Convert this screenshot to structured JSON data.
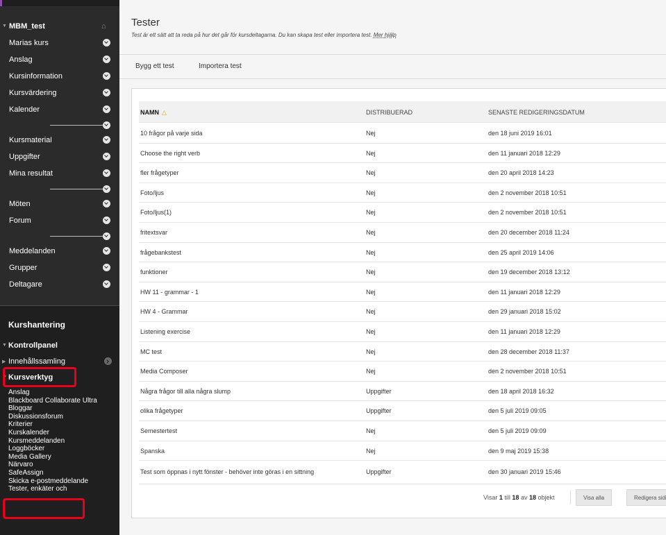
{
  "sidebar": {
    "course_title": "MBM_test",
    "groups": [
      [
        "Marias kurs",
        "Anslag",
        "Kursinformation",
        "Kursvärdering",
        "Kalender"
      ],
      [
        "Kursmaterial",
        "Uppgifter",
        "Mina resultat"
      ],
      [
        "Möten",
        "Forum"
      ],
      [
        "Meddelanden",
        "Grupper",
        "Deltagare"
      ]
    ],
    "management": {
      "title": "Kurshantering",
      "control_panel": "Kontrollpanel",
      "content_collection": "Innehållssamling",
      "course_tools": "Kursverktyg",
      "tools": [
        "Anslag",
        "Blackboard Collaborate Ultra",
        "Bloggar",
        "Diskussionsforum",
        "Kriterier",
        "Kurskalender",
        "Kursmeddelanden",
        "Loggböcker",
        "Media Gallery",
        "Närvaro",
        "SafeAssign",
        "Skicka e-postmeddelande",
        "Tester, enkäter och"
      ]
    },
    "highlight_color": "#e8001c"
  },
  "main": {
    "title": "Tester",
    "description": "Test är ett sätt att ta reda på hur det går för kursdeltagarna. Du kan skapa test eller importera test.",
    "help_link": "Mer hjälp",
    "toolbar": {
      "build_test": "Bygg ett test",
      "import_test": "Importera test"
    },
    "table": {
      "columns": [
        "NAMN",
        "DISTRIBUERAD",
        "SENASTE REDIGERINGSDATUM"
      ],
      "rows": [
        [
          "10 frågor på varje sida",
          "Nej",
          "den 18 juni 2019 16:01"
        ],
        [
          "Choose the right verb",
          "Nej",
          "den 11 januari 2018 12:29"
        ],
        [
          "fler frågetyper",
          "Nej",
          "den 20 april 2018 14:23"
        ],
        [
          "Foto/ljus",
          "Nej",
          "den 2 november 2018 10:51"
        ],
        [
          "Foto/ljus(1)",
          "Nej",
          "den 2 november 2018 10:51"
        ],
        [
          "fritextsvar",
          "Nej",
          "den 20 december 2018 11:24"
        ],
        [
          "frågebankstest",
          "Nej",
          "den 25 april 2019 14:06"
        ],
        [
          "funktioner",
          "Nej",
          "den 19 december 2018 13:12"
        ],
        [
          "HW 11 - grammar - 1",
          "Nej",
          "den 11 januari 2018 12:29"
        ],
        [
          "HW 4 - Grammar",
          "Nej",
          "den 29 januari 2018 15:02"
        ],
        [
          "Listening exercise",
          "Nej",
          "den 11 januari 2018 12:29"
        ],
        [
          "MC test",
          "Nej",
          "den 28 december 2018 11:37"
        ],
        [
          "Media Composer",
          "Nej",
          "den 2 november 2018 10:51"
        ],
        [
          "Några frågor till alla några slump",
          "Uppgifter",
          "den 18 april 2018 16:32"
        ],
        [
          "olika frågetyper",
          "Uppgifter",
          "den 5 juli 2019 09:05"
        ],
        [
          "Semestertest",
          "Nej",
          "den 5 juli 2019 09:09"
        ],
        [
          "Spanska",
          "Nej",
          "den 9 maj 2019 15:38"
        ],
        [
          "Test som öppnas i nytt fönster - behöver inte göras i en sittning",
          "Uppgifter",
          "den 30 januari 2019 15:46"
        ]
      ]
    },
    "footer": {
      "info_prefix": "Visar",
      "info_from": "1",
      "info_mid": "till",
      "info_to": "18",
      "info_of": "av",
      "info_total": "18",
      "info_suffix": "objekt",
      "show_all": "Visa alla",
      "edit_paging": "Redigera sidindelning"
    }
  }
}
